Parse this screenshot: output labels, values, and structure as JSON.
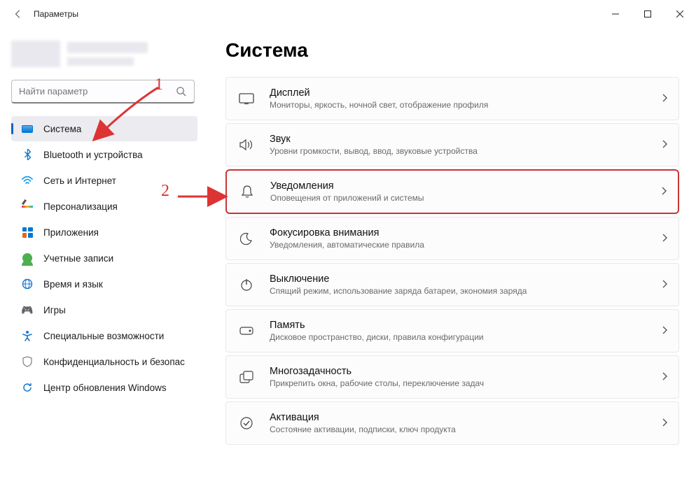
{
  "window": {
    "title": "Параметры"
  },
  "search": {
    "placeholder": "Найти параметр"
  },
  "sidebar": {
    "items": [
      {
        "label": "Система"
      },
      {
        "label": "Bluetooth и устройства"
      },
      {
        "label": "Сеть и Интернет"
      },
      {
        "label": "Персонализация"
      },
      {
        "label": "Приложения"
      },
      {
        "label": "Учетные записи"
      },
      {
        "label": "Время и язык"
      },
      {
        "label": "Игры"
      },
      {
        "label": "Специальные возможности"
      },
      {
        "label": "Конфиденциальность и безопас"
      },
      {
        "label": "Центр обновления Windows"
      }
    ]
  },
  "main": {
    "heading": "Система",
    "cards": [
      {
        "title": "Дисплей",
        "subtitle": "Мониторы, яркость, ночной свет, отображение профиля"
      },
      {
        "title": "Звук",
        "subtitle": "Уровни громкости, вывод, ввод, звуковые устройства"
      },
      {
        "title": "Уведомления",
        "subtitle": "Оповещения от приложений и системы"
      },
      {
        "title": "Фокусировка внимания",
        "subtitle": "Уведомления, автоматические правила"
      },
      {
        "title": "Выключение",
        "subtitle": "Спящий режим, использование заряда батареи, экономия заряда"
      },
      {
        "title": "Память",
        "subtitle": "Дисковое пространство, диски, правила конфигурации"
      },
      {
        "title": "Многозадачность",
        "subtitle": "Прикрепить окна, рабочие столы, переключение задач"
      },
      {
        "title": "Активация",
        "subtitle": "Состояние активации, подписки, ключ продукта"
      }
    ]
  },
  "annotations": {
    "n1": "1",
    "n2": "2"
  }
}
